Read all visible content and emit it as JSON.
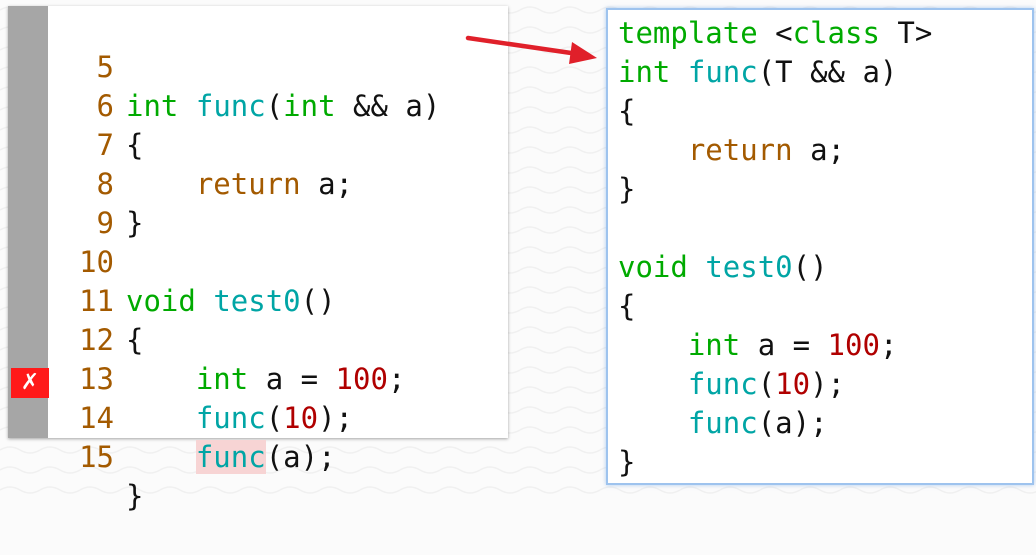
{
  "left_panel": {
    "lines": [
      {
        "num": "5",
        "t": [
          "int",
          " ",
          "func",
          "(",
          "int",
          " && a)"
        ]
      },
      {
        "num": "6",
        "t": [
          "{"
        ]
      },
      {
        "num": "7",
        "t": [
          "    ",
          "return",
          " a;"
        ]
      },
      {
        "num": "8",
        "t": [
          "}"
        ]
      },
      {
        "num": "9",
        "t": [
          ""
        ]
      },
      {
        "num": "10",
        "t": [
          "void",
          " ",
          "test0",
          "()"
        ]
      },
      {
        "num": "11",
        "t": [
          "{"
        ]
      },
      {
        "num": "12",
        "t": [
          "    ",
          "int",
          " a = ",
          "100",
          ";"
        ]
      },
      {
        "num": "13",
        "t": [
          "    ",
          "func",
          "(",
          "10",
          ");"
        ]
      },
      {
        "num": "14",
        "t": [
          "    ",
          "func",
          "(a);"
        ]
      },
      {
        "num": "15",
        "t": [
          "}"
        ]
      }
    ],
    "error_marker": "✗"
  },
  "right_panel": {
    "lines": [
      {
        "t": [
          "template",
          " <",
          "class",
          " T>"
        ]
      },
      {
        "t": [
          "int",
          " ",
          "func",
          "(T && a)"
        ]
      },
      {
        "t": [
          "{"
        ]
      },
      {
        "t": [
          "    ",
          "return",
          " a;"
        ]
      },
      {
        "t": [
          "}"
        ]
      },
      {
        "t": [
          ""
        ]
      },
      {
        "t": [
          "void",
          " ",
          "test0",
          "()"
        ]
      },
      {
        "t": [
          "{"
        ]
      },
      {
        "t": [
          "    ",
          "int",
          " a = ",
          "100",
          ";"
        ]
      },
      {
        "t": [
          "    ",
          "func",
          "(",
          "10",
          ");"
        ]
      },
      {
        "t": [
          "    ",
          "func",
          "(a);"
        ]
      },
      {
        "t": [
          "}"
        ]
      }
    ]
  },
  "colors": {
    "type_keyword": "#00aa00",
    "control_keyword": "#a35a00",
    "function": "#00a5a5",
    "number": "#b00000",
    "error": "#ff1a1a",
    "arrow": "#e0202a"
  }
}
